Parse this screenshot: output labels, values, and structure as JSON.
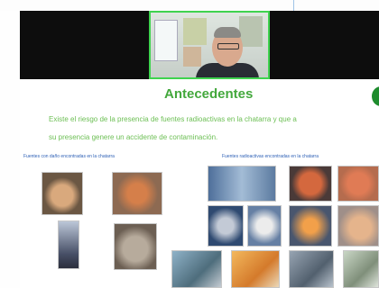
{
  "slide": {
    "title": "Antecedentes",
    "line1": "Existe el riesgo de la presencia de fuentes radioactivas en la chatarra y que a",
    "line2": "su presencia genere un accidente de contaminación.",
    "left_caption": "Fuentes con daño encontradas en la chatarra",
    "right_caption": "Fuentes radioactivas encontradas en la chatarra"
  },
  "colors": {
    "title": "#43a83c",
    "body_text": "#6cbf54",
    "caption": "#2c5fb5",
    "video_border": "#3fd34f"
  }
}
